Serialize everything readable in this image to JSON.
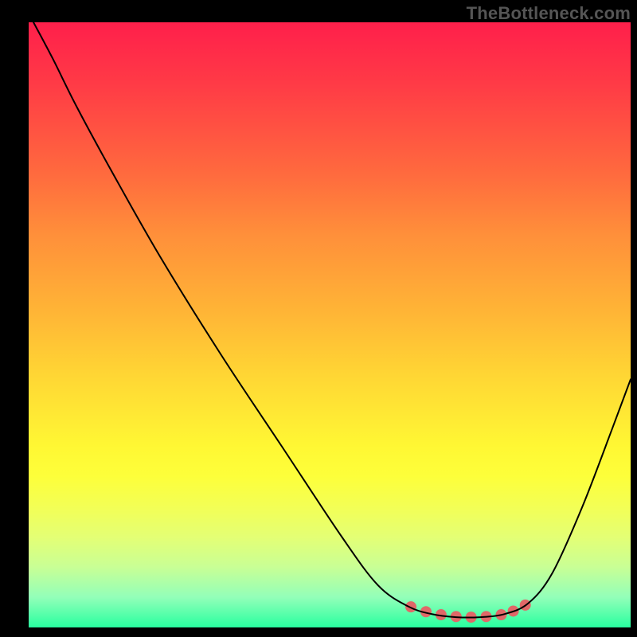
{
  "watermark": "TheBottleneck.com",
  "chart_data": {
    "type": "line",
    "title": "",
    "xlabel": "",
    "ylabel": "",
    "xlim": [
      0,
      100
    ],
    "ylim": [
      0,
      100
    ],
    "main_curve": {
      "name": "valley",
      "stroke": "#000000",
      "stroke_width": 2,
      "fill": "none",
      "points": [
        {
          "x": 0.8,
          "y": 100
        },
        {
          "x": 4.0,
          "y": 94
        },
        {
          "x": 8.0,
          "y": 86
        },
        {
          "x": 14.0,
          "y": 75
        },
        {
          "x": 22.0,
          "y": 61
        },
        {
          "x": 32.0,
          "y": 45
        },
        {
          "x": 42.0,
          "y": 30
        },
        {
          "x": 52.0,
          "y": 15
        },
        {
          "x": 58.0,
          "y": 7
        },
        {
          "x": 63.0,
          "y": 3.5
        },
        {
          "x": 67.0,
          "y": 2.2
        },
        {
          "x": 71.0,
          "y": 1.7
        },
        {
          "x": 75.0,
          "y": 1.7
        },
        {
          "x": 79.0,
          "y": 2.2
        },
        {
          "x": 83.0,
          "y": 4.0
        },
        {
          "x": 87.0,
          "y": 9.0
        },
        {
          "x": 92.0,
          "y": 20.0
        },
        {
          "x": 97.0,
          "y": 33.0
        },
        {
          "x": 100,
          "y": 41.0
        }
      ]
    },
    "marker_band": {
      "name": "sweet-spot-markers",
      "fill": "#e06868",
      "radius": 7,
      "points": [
        {
          "x": 63.5,
          "y": 3.4
        },
        {
          "x": 66.0,
          "y": 2.6
        },
        {
          "x": 68.5,
          "y": 2.1
        },
        {
          "x": 71.0,
          "y": 1.8
        },
        {
          "x": 73.5,
          "y": 1.7
        },
        {
          "x": 76.0,
          "y": 1.8
        },
        {
          "x": 78.5,
          "y": 2.1
        },
        {
          "x": 80.5,
          "y": 2.7
        },
        {
          "x": 82.5,
          "y": 3.7
        }
      ]
    }
  }
}
